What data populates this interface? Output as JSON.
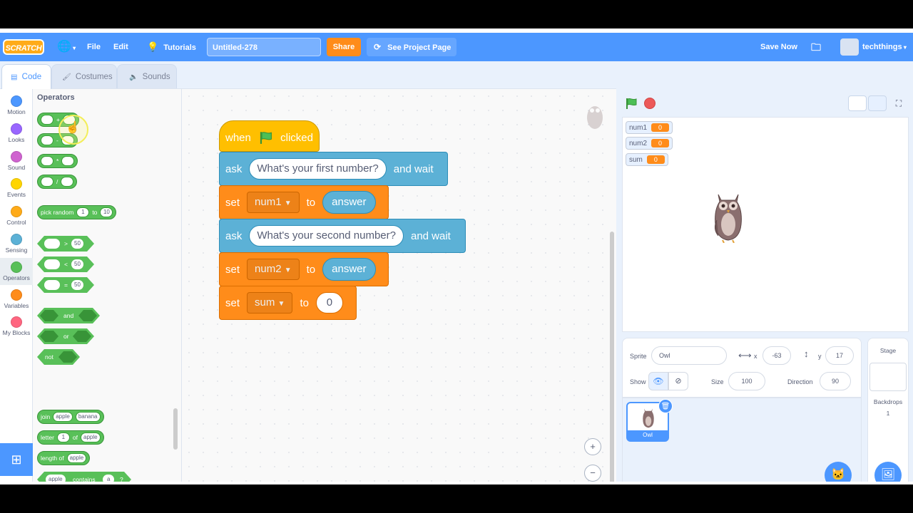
{
  "menubar": {
    "logo": "SCRATCH",
    "file": "File",
    "edit": "Edit",
    "tutorials": "Tutorials",
    "project_title": "Untitled-278",
    "share": "Share",
    "see_project": "See Project Page",
    "save_now": "Save Now",
    "username": "techthings"
  },
  "tabs": {
    "code": "Code",
    "costumes": "Costumes",
    "sounds": "Sounds"
  },
  "categories": [
    {
      "label": "Motion",
      "color": "#4c97ff"
    },
    {
      "label": "Looks",
      "color": "#9966ff"
    },
    {
      "label": "Sound",
      "color": "#cf63cf"
    },
    {
      "label": "Events",
      "color": "#ffd500"
    },
    {
      "label": "Control",
      "color": "#ffab19"
    },
    {
      "label": "Sensing",
      "color": "#5cb1d6"
    },
    {
      "label": "Operators",
      "color": "#59c059"
    },
    {
      "label": "Variables",
      "color": "#ff8c1a"
    },
    {
      "label": "My Blocks",
      "color": "#ff6680"
    }
  ],
  "palette": {
    "heading": "Operators",
    "add": "+",
    "sub": "-",
    "mul": "*",
    "div": "/",
    "pick_random": "pick random",
    "pr_from": "1",
    "pr_to": "to",
    "pr_to_val": "10",
    "gt": ">",
    "lt": "<",
    "eq": "=",
    "cmp_val": "50",
    "and": "and",
    "or": "or",
    "not": "not",
    "join": "join",
    "apple": "apple",
    "banana": "banana",
    "letter": "letter",
    "letter_idx": "1",
    "of": "of",
    "length_of": "length of",
    "contains": "contains",
    "a": "a",
    "q": "?"
  },
  "script": {
    "when": "when",
    "clicked": "clicked",
    "ask": "ask",
    "and_wait": "and wait",
    "q1": "What's your first number?",
    "q2": "What's your second number?",
    "set": "set",
    "to": "to",
    "num1": "num1",
    "num2": "num2",
    "sum": "sum",
    "answer": "answer",
    "zero": "0"
  },
  "zoom": {
    "in": "+",
    "out": "−",
    "reset": "="
  },
  "monitors": [
    {
      "name": "num1",
      "value": "0"
    },
    {
      "name": "num2",
      "value": "0"
    },
    {
      "name": "sum",
      "value": "0"
    }
  ],
  "sprite_info": {
    "sprite_label": "Sprite",
    "sprite_name": "Owl",
    "x_label": "x",
    "x": "-63",
    "y_label": "y",
    "y": "17",
    "show_label": "Show",
    "size_label": "Size",
    "size": "100",
    "direction_label": "Direction",
    "direction": "90"
  },
  "sprite_card": {
    "name": "Owl"
  },
  "stage_panel": {
    "title": "Stage",
    "backdrops_label": "Backdrops",
    "backdrops_count": "1"
  }
}
